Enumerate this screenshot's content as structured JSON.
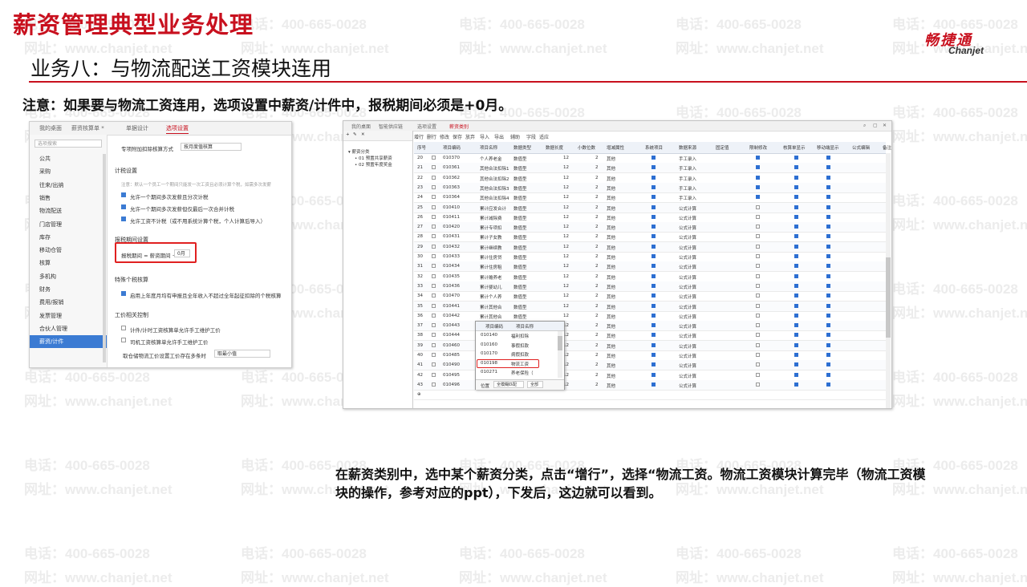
{
  "main_title": "薪资管理典型业务处理",
  "logo": {
    "cn": "畅捷通",
    "en": "Chanjet"
  },
  "sub_title": "业务八：与物流配送工资模块连用",
  "note": "注意：如果要与物流工资连用，选项设置中薪资/计件中，报税期间必须是+0月。",
  "description": "在薪资类别中，选中某个薪资分类，点击“增行”，选择“物流工资。物流工资模块计算完毕（物流工资模块的操作，参考对应的ppt），下发后，这边就可以看到。",
  "watermark": {
    "phone": "电话：400-665-0028",
    "site": "网址：www.chanjet.net"
  },
  "left_screen": {
    "tabs": [
      "我的桌面",
      "薪资核算单 *",
      "单据设计",
      "选项设置"
    ],
    "search_placeholder": "选项搜索",
    "sidebar": [
      "公共",
      "采购",
      "往来/出纳",
      "销售",
      "物流配送",
      "门店管理",
      "库存",
      "移动仓管",
      "核算",
      "多机构",
      "财务",
      "费用/报销",
      "发票管理",
      "合伙人管理",
      "薪资/计件"
    ],
    "top_label": "专项附加扣除核算方式",
    "top_select": "按月度值核算",
    "sec_tax": "计税设置",
    "tax_hint": "注意：默认一个员工一个期间只能发一次工资且必须计算个税，如需多次发薪",
    "tax_opts": [
      "允许一个期间多次发薪且分次计税",
      "允许一个期间多次发薪但仅最后一次合并计税",
      "允许工资不计税（或不用系统计算个税，个人计算后导入）"
    ],
    "sec_period": "报税期间设置",
    "period_label": "报税期间 = 薪资期间 +",
    "period_value": "0月",
    "sec_special": "特殊个税核算",
    "special_opt": "启用上年度月均有申报且全年收入不超过全年起征扣除的个税核算",
    "sec_wage": "工价相关控制",
    "wage_opts": [
      "计件/计时工资核算单允许手工维护工价",
      "司机工资核算单允许手工维护工价"
    ],
    "wage_label": "取仓储物流工价设置工价存在多条时",
    "wage_select": "取最小值"
  },
  "right_screen": {
    "tabs": [
      "我的桌面",
      "智能供应链",
      "选项设置",
      "薪资类别"
    ],
    "tree": [
      "薪资分类",
      "01 预置共享薪资",
      "02 预置年度奖金"
    ],
    "toolbar": [
      "增行",
      "删行",
      "修改",
      "保存",
      "放弃",
      "导入",
      "导出",
      "辅助",
      "字段",
      "适应"
    ],
    "headers": [
      "序号",
      "",
      "项目编码",
      "项目名称",
      "数据类型",
      "数据长度",
      "小数位数",
      "增减属性",
      "系统项目",
      "数据来源",
      "固定值",
      "限制修改",
      "核算单显示",
      "移动端显示",
      "公式编辑",
      "备注"
    ],
    "rows": [
      {
        "no": "20",
        "code": "010370",
        "name": "个人养老金",
        "type": "数值型",
        "len": "12",
        "dec": "2",
        "attr": "其他",
        "src": "手工录入"
      },
      {
        "no": "21",
        "code": "010361",
        "name": "其他合法扣除1",
        "type": "数值型",
        "len": "12",
        "dec": "2",
        "attr": "其他",
        "src": "手工录入"
      },
      {
        "no": "22",
        "code": "010362",
        "name": "其他合法扣除2",
        "type": "数值型",
        "len": "12",
        "dec": "2",
        "attr": "其他",
        "src": "手工录入"
      },
      {
        "no": "23",
        "code": "010363",
        "name": "其他合法扣除3",
        "type": "数值型",
        "len": "12",
        "dec": "2",
        "attr": "其他",
        "src": "手工录入"
      },
      {
        "no": "24",
        "code": "010364",
        "name": "其他合法扣除4",
        "type": "数值型",
        "len": "12",
        "dec": "2",
        "attr": "其他",
        "src": "手工录入"
      },
      {
        "no": "25",
        "code": "010410",
        "name": "累计应发合计",
        "type": "数值型",
        "len": "12",
        "dec": "2",
        "attr": "其他",
        "src": "公式计算"
      },
      {
        "no": "26",
        "code": "010411",
        "name": "累计减除费",
        "type": "数值型",
        "len": "12",
        "dec": "2",
        "attr": "其他",
        "src": "公式计算"
      },
      {
        "no": "27",
        "code": "010420",
        "name": "累计专项扣",
        "type": "数值型",
        "len": "12",
        "dec": "2",
        "attr": "其他",
        "src": "公式计算"
      },
      {
        "no": "28",
        "code": "010431",
        "name": "累计子女教",
        "type": "数值型",
        "len": "12",
        "dec": "2",
        "attr": "其他",
        "src": "公式计算"
      },
      {
        "no": "29",
        "code": "010432",
        "name": "累计继续教",
        "type": "数值型",
        "len": "12",
        "dec": "2",
        "attr": "其他",
        "src": "公式计算"
      },
      {
        "no": "30",
        "code": "010433",
        "name": "累计住房贷",
        "type": "数值型",
        "len": "12",
        "dec": "2",
        "attr": "其他",
        "src": "公式计算"
      },
      {
        "no": "31",
        "code": "010434",
        "name": "累计住房租",
        "type": "数值型",
        "len": "12",
        "dec": "2",
        "attr": "其他",
        "src": "公式计算"
      },
      {
        "no": "32",
        "code": "010435",
        "name": "累计赡养老",
        "type": "数值型",
        "len": "12",
        "dec": "2",
        "attr": "其他",
        "src": "公式计算"
      },
      {
        "no": "33",
        "code": "010436",
        "name": "累计婴幼儿",
        "type": "数值型",
        "len": "12",
        "dec": "2",
        "attr": "其他",
        "src": "公式计算"
      },
      {
        "no": "34",
        "code": "010470",
        "name": "累计个人养",
        "type": "数值型",
        "len": "12",
        "dec": "2",
        "attr": "其他",
        "src": "公式计算"
      },
      {
        "no": "35",
        "code": "010441",
        "name": "累计其他合",
        "type": "数值型",
        "len": "12",
        "dec": "2",
        "attr": "其他",
        "src": "公式计算"
      },
      {
        "no": "36",
        "code": "010442",
        "name": "累计其他合",
        "type": "数值型",
        "len": "12",
        "dec": "2",
        "attr": "其他",
        "src": "公式计算"
      },
      {
        "no": "37",
        "code": "010443",
        "name": "",
        "type": "",
        "len": "12",
        "dec": "2",
        "attr": "其他",
        "src": "公式计算"
      },
      {
        "no": "38",
        "code": "010444",
        "name": "",
        "type": "",
        "len": "12",
        "dec": "2",
        "attr": "其他",
        "src": "公式计算"
      },
      {
        "no": "39",
        "code": "010460",
        "name": "",
        "type": "",
        "len": "12",
        "dec": "2",
        "attr": "其他",
        "src": "公式计算"
      },
      {
        "no": "40",
        "code": "010485",
        "name": "",
        "type": "",
        "len": "12",
        "dec": "2",
        "attr": "其他",
        "src": "公式计算"
      },
      {
        "no": "41",
        "code": "010490",
        "name": "",
        "type": "",
        "len": "12",
        "dec": "2",
        "attr": "其他",
        "src": "公式计算"
      },
      {
        "no": "42",
        "code": "010495",
        "name": "",
        "type": "",
        "len": "12",
        "dec": "2",
        "attr": "其他",
        "src": "公式计算"
      },
      {
        "no": "43",
        "code": "010496",
        "name": "",
        "type": "",
        "len": "12",
        "dec": "2",
        "attr": "其他",
        "src": "公式计算"
      }
    ],
    "popup": {
      "headers": [
        "项目编码",
        "项目名称"
      ],
      "rows": [
        {
          "code": "010140",
          "name": "福利扣除"
        },
        {
          "code": "010160",
          "name": "事假扣款"
        },
        {
          "code": "010170",
          "name": "病假扣款"
        },
        {
          "code": "010198",
          "name": "物流工资"
        },
        {
          "code": "010271",
          "name": "养老保险（"
        }
      ],
      "footer": [
        "位置",
        "全模糊匹配",
        "全部"
      ]
    }
  }
}
